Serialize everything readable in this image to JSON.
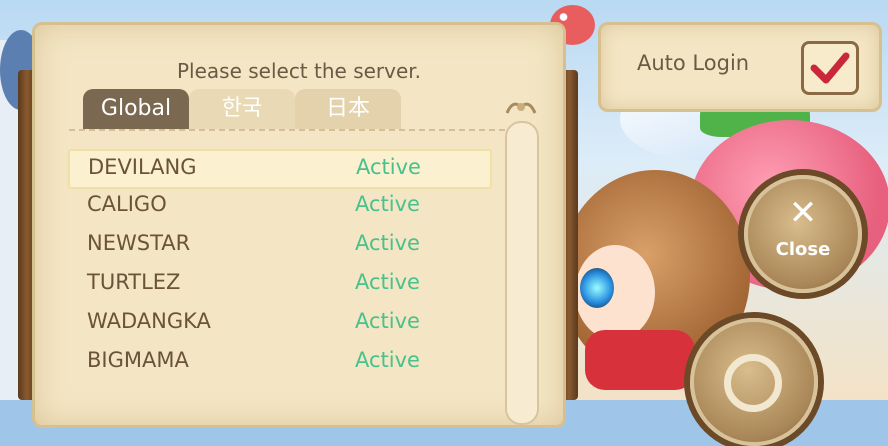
{
  "panel": {
    "title": "Please select the server.",
    "tabs": [
      {
        "label": "Global",
        "active": true
      },
      {
        "label": "한국",
        "active": false
      },
      {
        "label": "日本",
        "active": false
      }
    ]
  },
  "servers": [
    {
      "name": "DEVILANG",
      "status": "Active",
      "selected": true
    },
    {
      "name": "CALIGO",
      "status": "Active",
      "selected": false
    },
    {
      "name": "NEWSTAR",
      "status": "Active",
      "selected": false
    },
    {
      "name": "TURTLEZ",
      "status": "Active",
      "selected": false
    },
    {
      "name": "WADANGKA",
      "status": "Active",
      "selected": false
    },
    {
      "name": "BIGMAMA",
      "status": "Active",
      "selected": false
    }
  ],
  "auto_login": {
    "label": "Auto Login",
    "checked": true
  },
  "close_button": {
    "label": "Close"
  },
  "colors": {
    "status_active": "#48c18c",
    "server_name": "#6b5337",
    "panel_bg": "#f4e6c4",
    "checkmark": "#c8283a"
  },
  "icons": {
    "close": "x-icon",
    "confirm": "circle-icon",
    "check": "checkmark-icon"
  }
}
